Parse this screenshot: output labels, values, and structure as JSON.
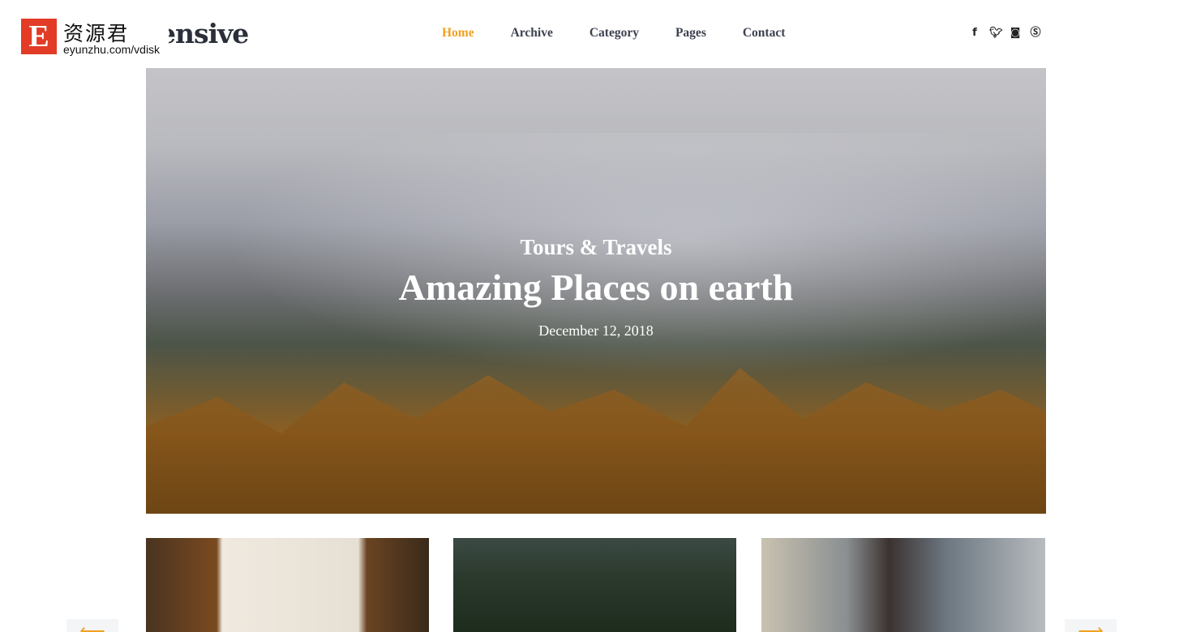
{
  "header": {
    "logo_text": "ensive",
    "watermark": {
      "letter": "E",
      "chinese": "资源君",
      "url": "eyunzhu.com/vdisk"
    },
    "nav": [
      {
        "label": "Home",
        "active": true
      },
      {
        "label": "Archive"
      },
      {
        "label": "Category"
      },
      {
        "label": "Pages"
      },
      {
        "label": "Contact"
      }
    ],
    "social": [
      "facebook-icon",
      "twitter-icon",
      "instagram-icon",
      "skype-icon"
    ],
    "accent": "#f0a122"
  },
  "hero": {
    "category": "Tours & Travels",
    "title": "Amazing Places on earth",
    "date": "December 12, 2018"
  },
  "carousel": {
    "prev_icon": "arrow-left-icon",
    "next_icon": "arrow-right-icon"
  }
}
